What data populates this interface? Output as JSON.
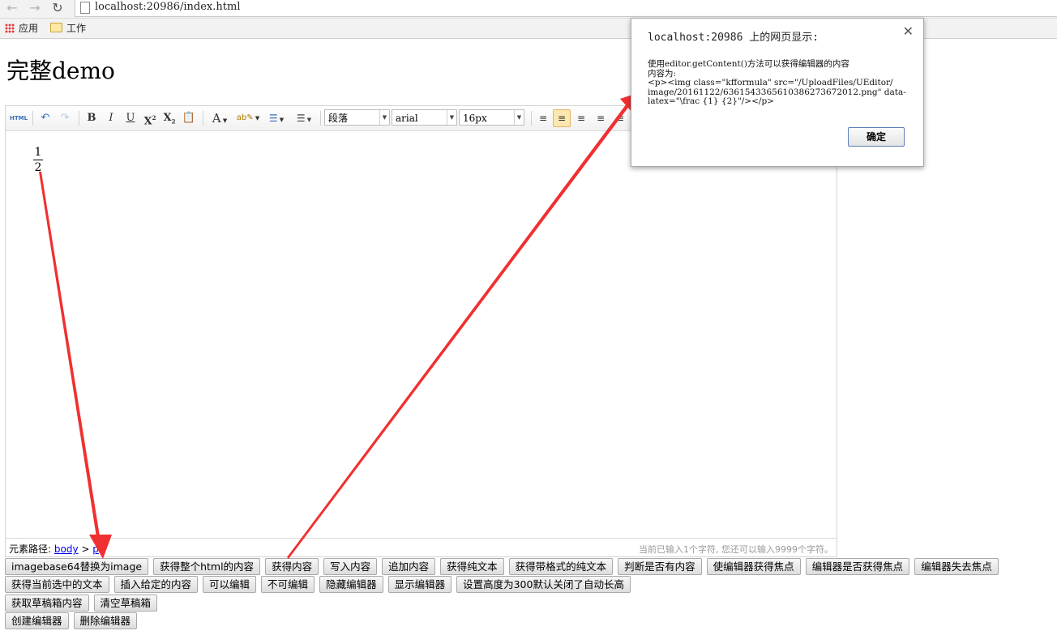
{
  "browser": {
    "url": "localhost:20986/index.html",
    "bookmarks": [
      {
        "label": "应用",
        "icon": "apps-grid-icon"
      },
      {
        "label": "工作",
        "icon": "folder-icon"
      }
    ]
  },
  "page": {
    "title": "完整demo"
  },
  "toolbar": {
    "source_label": "HTML",
    "paragraph": "段落",
    "font_family": "arial",
    "font_size": "16px"
  },
  "editor": {
    "numerator": "1",
    "denominator": "2",
    "path_label": "元素路径:",
    "path_body": "body",
    "path_sep": ">",
    "path_p": "p",
    "word_count": "当前已输入1个字符, 您还可以输入9999个字符。"
  },
  "buttons": {
    "row1": [
      "imagebase64替换为image",
      "获得整个html的内容",
      "获得内容",
      "写入内容",
      "追加内容",
      "获得纯文本",
      "获得带格式的纯文本",
      "判断是否有内容",
      "使编辑器获得焦点",
      "编辑器是否获得焦点",
      "编辑器失去焦点"
    ],
    "row2": [
      "获得当前选中的文本",
      "插入给定的内容",
      "可以编辑",
      "不可编辑",
      "隐藏编辑器",
      "显示编辑器",
      "设置高度为300默认关闭了自动长高"
    ],
    "row3": [
      "获取草稿箱内容",
      "清空草稿箱"
    ],
    "row4": [
      "创建编辑器",
      "删除编辑器"
    ]
  },
  "dialog": {
    "title": "localhost:20986 上的网页显示:",
    "line1": "使用editor.getContent()方法可以获得编辑器的内容",
    "line2": "内容为:",
    "line3": "<p><img class=\"kfformula\" src=\"/UploadFiles/UEditor/",
    "line4": "image/20161122/6361543365610386273672012.png\" data-",
    "line5": "latex=\"\\frac {1} {2}\"/></p>",
    "ok": "确定"
  },
  "annotation_color": "#f03030"
}
